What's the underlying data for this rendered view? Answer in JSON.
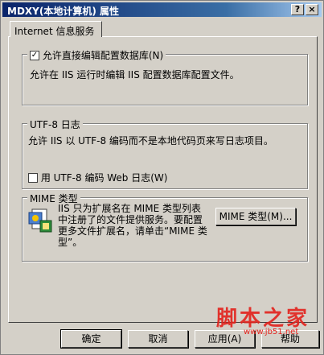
{
  "window": {
    "title": "MDXY(本地计算机) 属性"
  },
  "title_buttons": {
    "help": "?",
    "close": "×"
  },
  "tab": {
    "label": "Internet 信息服务"
  },
  "edit_config": {
    "checkbox_label": "允许直接编辑配置数据库(N)",
    "checked": true,
    "description": "允许在 IIS 运行时编辑 IIS 配置数据库配置文件。"
  },
  "utf8_log": {
    "legend": "UTF-8 日志",
    "description": "允许 IIS 以 UTF-8 编码而不是本地代码页来写日志项目。",
    "checkbox_label": "用 UTF-8 编码 Web 日志(W)",
    "checked": false
  },
  "mime": {
    "legend": "MIME 类型",
    "description_lines": [
      "IIS 只为扩展名在 MIME 类型列表",
      "中注册了的文件提供服务。要配置",
      "更多文件扩展名，请单击“MIME 类",
      "型”。"
    ],
    "button_label": "MIME 类型(M)..."
  },
  "buttons": {
    "ok": "确定",
    "cancel": "取消",
    "apply": "应用(A)",
    "help": "帮助"
  },
  "watermark": {
    "text": "脚本之家",
    "url": "www.jb51.net"
  }
}
